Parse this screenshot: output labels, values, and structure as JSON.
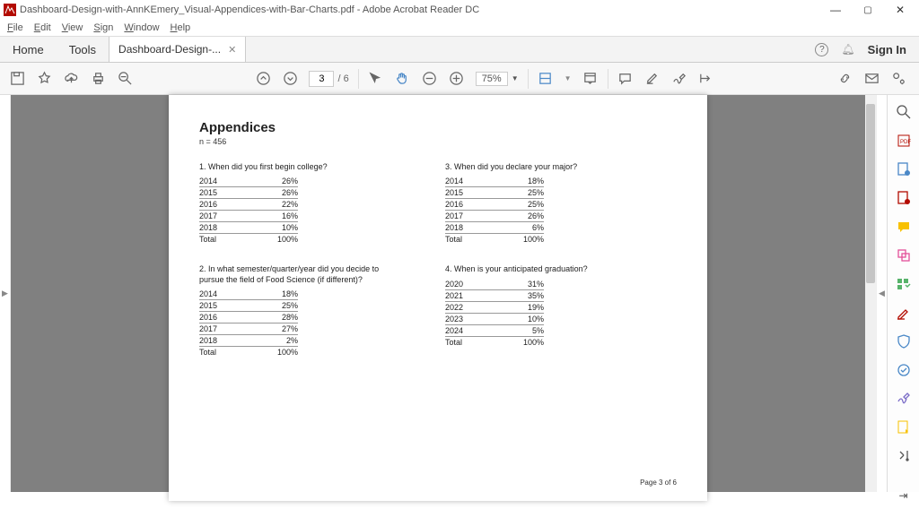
{
  "window": {
    "title": "Dashboard-Design-with-AnnKEmery_Visual-Appendices-with-Bar-Charts.pdf - Adobe Acrobat Reader DC"
  },
  "menu": {
    "file": "File",
    "edit": "Edit",
    "view": "View",
    "sign": "Sign",
    "window": "Window",
    "help": "Help"
  },
  "tabs": {
    "home": "Home",
    "tools": "Tools",
    "doc": "Dashboard-Design-...",
    "signin": "Sign In"
  },
  "toolbar": {
    "page_current": "3",
    "page_total": "/ 6",
    "zoom": "75%"
  },
  "page": {
    "title": "Appendices",
    "subtitle": "n = 456",
    "footer": "Page 3 of 6",
    "q1": {
      "label": "1. When did you first begin college?",
      "rows": [
        [
          "2014",
          "26%"
        ],
        [
          "2015",
          "26%"
        ],
        [
          "2016",
          "22%"
        ],
        [
          "2017",
          "16%"
        ],
        [
          "2018",
          "10%"
        ]
      ],
      "total": [
        "Total",
        "100%"
      ]
    },
    "q2": {
      "label": "2. In what semester/quarter/year did you decide to pursue the field of Food Science (if different)?",
      "rows": [
        [
          "2014",
          "18%"
        ],
        [
          "2015",
          "25%"
        ],
        [
          "2016",
          "28%"
        ],
        [
          "2017",
          "27%"
        ],
        [
          "2018",
          "2%"
        ]
      ],
      "total": [
        "Total",
        "100%"
      ]
    },
    "q3": {
      "label": "3. When did you declare your major?",
      "rows": [
        [
          "2014",
          "18%"
        ],
        [
          "2015",
          "25%"
        ],
        [
          "2016",
          "25%"
        ],
        [
          "2017",
          "26%"
        ],
        [
          "2018",
          "6%"
        ]
      ],
      "total": [
        "Total",
        "100%"
      ]
    },
    "q4": {
      "label": "4. When is your anticipated graduation?",
      "rows": [
        [
          "2020",
          "31%"
        ],
        [
          "2021",
          "35%"
        ],
        [
          "2022",
          "19%"
        ],
        [
          "2023",
          "10%"
        ],
        [
          "2024",
          "5%"
        ]
      ],
      "total": [
        "Total",
        "100%"
      ]
    }
  }
}
